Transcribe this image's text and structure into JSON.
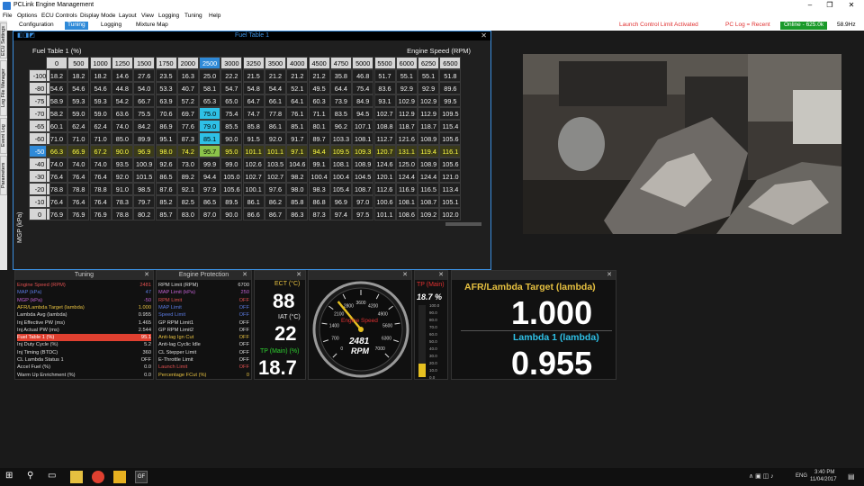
{
  "app": {
    "title": "PCLink Engine Management"
  },
  "menu": [
    "File",
    "Options",
    "ECU Controls",
    "Display Mode",
    "Layout",
    "View",
    "Logging",
    "Tuning",
    "Help"
  ],
  "tabs": [
    "Configuration",
    "Tuning",
    "Logging",
    "Mixture Map"
  ],
  "status": {
    "launch": "Launch Control Limit Activated",
    "pclog": "PC Log = Recent",
    "online": "Online - 625.0k",
    "hz": "58.9Hz"
  },
  "side_tabs": [
    "ECU Settings",
    "Log File Manager",
    "Event Log",
    "Parameters"
  ],
  "fuel_table": {
    "window_title": "Fuel Table 1",
    "label": "Fuel Table 1 (%)",
    "x_label": "Engine Speed (RPM)",
    "y_label": "MGP (kPa)",
    "rpm": [
      "0",
      "500",
      "1000",
      "1250",
      "1500",
      "1750",
      "2000",
      "2500",
      "3000",
      "3250",
      "3500",
      "4000",
      "4500",
      "4750",
      "5000",
      "5500",
      "6000",
      "6250",
      "6500"
    ],
    "mgp": [
      "-100",
      "-80",
      "-75",
      "-70",
      "-65",
      "-60",
      "-50",
      "-40",
      "-30",
      "-20",
      "-10",
      "0"
    ],
    "rows": [
      [
        "18.2",
        "18.2",
        "18.2",
        "14.6",
        "27.6",
        "23.5",
        "16.3",
        "25.0",
        "22.2",
        "21.5",
        "21.2",
        "21.2",
        "21.2",
        "35.8",
        "46.8",
        "51.7",
        "55.1",
        "55.1",
        "51.8"
      ],
      [
        "54.6",
        "54.6",
        "54.6",
        "44.8",
        "54.0",
        "53.3",
        "40.7",
        "58.1",
        "54.7",
        "54.8",
        "54.4",
        "52.1",
        "49.5",
        "64.4",
        "75.4",
        "83.6",
        "92.9",
        "92.9",
        "89.6"
      ],
      [
        "58.9",
        "59.3",
        "59.3",
        "54.2",
        "66.7",
        "63.9",
        "57.2",
        "65.3",
        "65.0",
        "64.7",
        "66.1",
        "64.1",
        "60.3",
        "73.9",
        "84.9",
        "93.1",
        "102.9",
        "102.9",
        "99.5"
      ],
      [
        "58.2",
        "59.0",
        "59.0",
        "63.6",
        "75.5",
        "70.6",
        "69.7",
        "75.0",
        "75.4",
        "74.7",
        "77.8",
        "76.1",
        "71.1",
        "83.5",
        "94.5",
        "102.7",
        "112.9",
        "112.9",
        "109.5"
      ],
      [
        "60.1",
        "62.4",
        "62.4",
        "74.0",
        "84.2",
        "86.9",
        "77.6",
        "79.0",
        "85.5",
        "85.8",
        "86.1",
        "85.1",
        "80.1",
        "96.2",
        "107.1",
        "108.8",
        "118.7",
        "118.7",
        "115.4"
      ],
      [
        "71.0",
        "71.0",
        "71.0",
        "85.0",
        "89.9",
        "95.1",
        "87.3",
        "85.1",
        "90.0",
        "91.5",
        "92.0",
        "91.7",
        "89.7",
        "103.3",
        "108.1",
        "112.7",
        "121.6",
        "108.9",
        "105.6"
      ],
      [
        "66.3",
        "66.9",
        "67.2",
        "90.0",
        "96.9",
        "98.0",
        "74.2",
        "95.7",
        "95.0",
        "101.1",
        "101.1",
        "97.1",
        "94.4",
        "109.5",
        "109.3",
        "120.7",
        "131.1",
        "119.4",
        "116.1"
      ],
      [
        "74.0",
        "74.0",
        "74.0",
        "93.5",
        "100.9",
        "92.6",
        "73.0",
        "99.9",
        "99.0",
        "102.6",
        "103.5",
        "104.6",
        "99.1",
        "108.1",
        "108.9",
        "124.6",
        "125.0",
        "108.9",
        "105.6"
      ],
      [
        "76.4",
        "76.4",
        "76.4",
        "92.0",
        "101.5",
        "86.5",
        "89.2",
        "94.4",
        "105.0",
        "102.7",
        "102.7",
        "98.2",
        "100.4",
        "100.4",
        "104.5",
        "120.1",
        "124.4",
        "124.4",
        "121.0"
      ],
      [
        "78.8",
        "78.8",
        "78.8",
        "91.0",
        "98.5",
        "87.6",
        "92.1",
        "97.9",
        "105.6",
        "100.1",
        "97.6",
        "98.0",
        "98.3",
        "105.4",
        "108.7",
        "112.6",
        "116.9",
        "116.5",
        "113.4"
      ],
      [
        "76.4",
        "76.4",
        "76.4",
        "78.3",
        "79.7",
        "85.2",
        "82.5",
        "86.5",
        "89.5",
        "86.1",
        "86.2",
        "85.8",
        "86.8",
        "96.9",
        "97.0",
        "100.6",
        "108.1",
        "108.7",
        "105.1"
      ],
      [
        "76.9",
        "76.9",
        "76.9",
        "78.8",
        "80.2",
        "85.7",
        "83.0",
        "87.0",
        "90.0",
        "86.6",
        "86.7",
        "86.3",
        "87.3",
        "97.4",
        "97.5",
        "101.1",
        "108.6",
        "109.2",
        "102.0"
      ]
    ]
  },
  "tuning": {
    "title": "Tuning",
    "rows": [
      {
        "label": "Engine Speed (RPM)",
        "value": "2481",
        "color": "#e05050"
      },
      {
        "label": "MAP (kPa)",
        "value": "47",
        "color": "#5a7ae0"
      },
      {
        "label": "MGP (kPa)",
        "value": "-50",
        "color": "#c060d0"
      },
      {
        "label": "AFR/Lambda Target (lambda)",
        "value": "1.000",
        "color": "#e6c040"
      },
      {
        "label": "Lambda Avg (lambda)",
        "value": "0.955",
        "color": "#dddddd"
      },
      {
        "label": "Inj Effective PW (ms)",
        "value": "1.465",
        "color": "#dddddd"
      },
      {
        "label": "Inj Actual PW (ms)",
        "value": "2.544",
        "color": "#dddddd"
      },
      {
        "label": "Fuel Table 1 (%)",
        "value": "95.1",
        "color": "#ffffff"
      },
      {
        "label": "Inj Duty Cycle (%)",
        "value": "5.2",
        "color": "#dddddd"
      },
      {
        "label": "Inj Timing (BTDC)",
        "value": "360",
        "color": "#dddddd"
      },
      {
        "label": "CL Lambda Status 1",
        "value": "OFF",
        "color": "#dddddd"
      },
      {
        "label": "Accel Fuel (%)",
        "value": "0.0",
        "color": "#dddddd"
      },
      {
        "label": "Warm Up Enrichment (%)",
        "value": "0.0",
        "color": "#dddddd"
      }
    ]
  },
  "protection": {
    "title": "Engine Protection",
    "rows": [
      {
        "label": "RPM Limit (RPM)",
        "value": "6700",
        "color": "#dddddd"
      },
      {
        "label": "MAP Limit (kPa)",
        "value": "250",
        "color": "#c060d0"
      },
      {
        "label": "RPM Limit",
        "value": "OFF",
        "color": "#e05050"
      },
      {
        "label": "MAP Limit",
        "value": "OFF",
        "color": "#5a7ae0"
      },
      {
        "label": "Speed Limit",
        "value": "OFF",
        "color": "#5a7ae0"
      },
      {
        "label": "GP RPM Limit1",
        "value": "OFF",
        "color": "#dddddd"
      },
      {
        "label": "GP RPM Limit2",
        "value": "OFF",
        "color": "#dddddd"
      },
      {
        "label": "Anti-lag Ign Cut",
        "value": "OFF",
        "color": "#e6c040"
      },
      {
        "label": "Anti-lag Cyclic Idle",
        "value": "OFF",
        "color": "#dddddd"
      },
      {
        "label": "CL Stepper Limit",
        "value": "OFF",
        "color": "#dddddd"
      },
      {
        "label": "E-Throttle Limit",
        "value": "OFF",
        "color": "#dddddd"
      },
      {
        "label": "Launch Limit",
        "value": "OFF",
        "color": "#e05050"
      },
      {
        "label": "Percentage FCut (%)",
        "value": "0",
        "color": "#e6c040"
      }
    ]
  },
  "gauges": {
    "ect_label": "ECT (°C)",
    "ect": "88",
    "iat_label": "IAT (°C)",
    "iat": "22",
    "tp_label": "TP (Main) (%)",
    "tp": "18.7",
    "rpm_label": "Engine Speed",
    "rpm": "2481",
    "rpm_unit": "RPM",
    "rpm_ticks": [
      "0",
      "700",
      "1400",
      "2100",
      "2800",
      "3600",
      "4200",
      "4900",
      "5600",
      "6300",
      "7000"
    ],
    "rpm_value": 2481,
    "rpm_max": 7000,
    "tpbar_label": "TP (Main)",
    "tpbar_value": "18.7 %",
    "tpbar_fraction": 0.187,
    "tpbar_ticks": [
      "100.0",
      "90.0",
      "80.0",
      "70.0",
      "60.0",
      "50.0",
      "40.0",
      "30.0",
      "20.0",
      "10.0",
      "0.0"
    ],
    "afr_label": "AFR/Lambda Target (lambda)",
    "afr": "1.000",
    "lambda_label": "Lambda 1 (lambda)",
    "lambda": "0.955"
  },
  "tray": {
    "lang": "ENG",
    "time": "3:40 PM",
    "date": "11/04/2017"
  }
}
